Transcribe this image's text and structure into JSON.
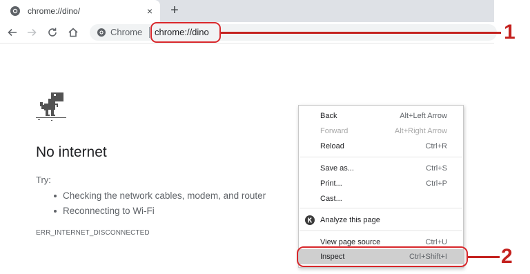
{
  "tab": {
    "title": "chrome://dino/",
    "close_glyph": "×",
    "new_tab_glyph": "+"
  },
  "toolbar": {
    "chip_label": "Chrome",
    "url": "chrome://dino"
  },
  "error_page": {
    "heading": "No internet",
    "try_label": "Try:",
    "suggestions": [
      "Checking the network cables, modem, and router",
      "Reconnecting to Wi-Fi"
    ],
    "error_code": "ERR_INTERNET_DISCONNECTED"
  },
  "context_menu": {
    "items": [
      {
        "label": "Back",
        "shortcut": "Alt+Left Arrow",
        "enabled": true
      },
      {
        "label": "Forward",
        "shortcut": "Alt+Right Arrow",
        "enabled": false
      },
      {
        "label": "Reload",
        "shortcut": "Ctrl+R",
        "enabled": true
      },
      {
        "label": "Save as...",
        "shortcut": "Ctrl+S",
        "enabled": true
      },
      {
        "label": "Print...",
        "shortcut": "Ctrl+P",
        "enabled": true
      },
      {
        "label": "Cast...",
        "shortcut": "",
        "enabled": true
      },
      {
        "label": "Analyze this page",
        "shortcut": "",
        "enabled": true,
        "icon": "extension-k-icon"
      },
      {
        "label": "View page source",
        "shortcut": "Ctrl+U",
        "enabled": true
      },
      {
        "label": "Inspect",
        "shortcut": "Ctrl+Shift+I",
        "enabled": true,
        "highlighted": true
      }
    ]
  },
  "annotations": {
    "callout_1": "1",
    "callout_2": "2"
  },
  "colors": {
    "annotation_red": "#c4221f",
    "highlight_border": "#d7262a",
    "tabstrip_bg": "#dee1e6",
    "omnibox_bg": "#f1f3f4",
    "menu_highlight": "#cfcfcf"
  },
  "icons": {
    "favicon": "chrome-globe-icon",
    "back": "arrow-left-icon",
    "forward": "arrow-right-icon",
    "reload": "reload-icon",
    "home": "home-icon",
    "chip": "chrome-info-icon",
    "dino": "dinosaur-icon"
  }
}
